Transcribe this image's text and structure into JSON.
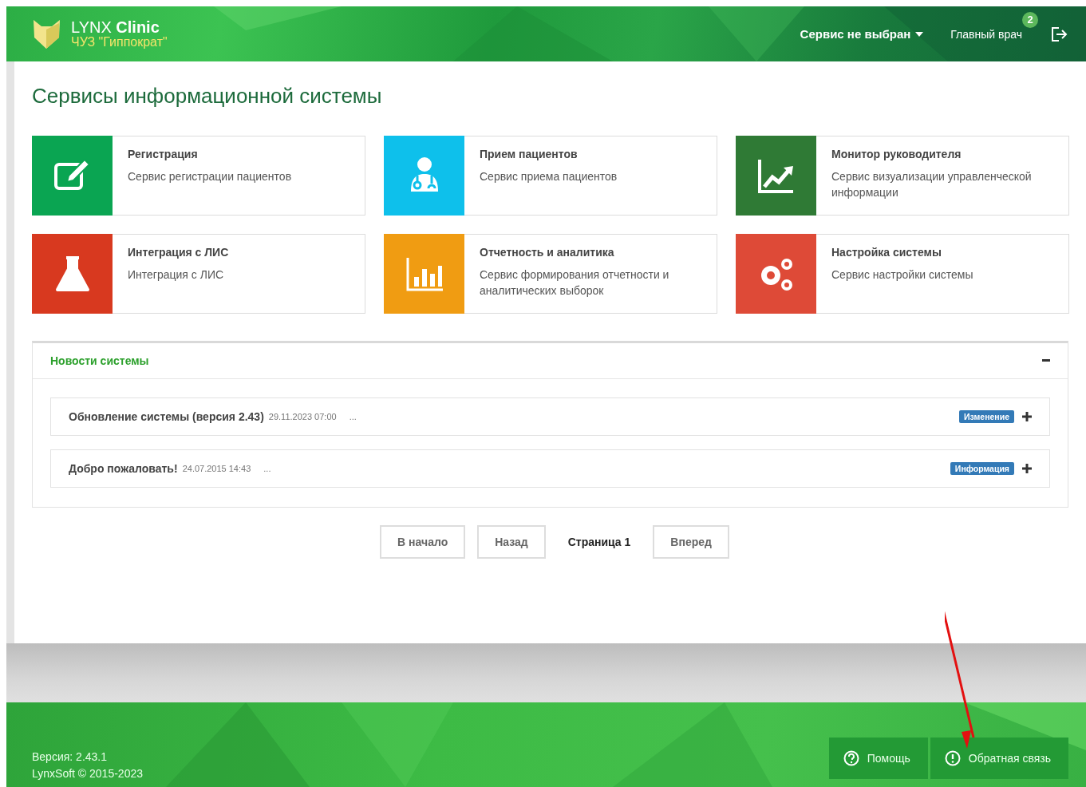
{
  "header": {
    "brand": "LYNX **Clinic**",
    "organization": "ЧУЗ \"Гиппократ\"",
    "service_menu": "Сервис не выбран",
    "user": "Главный врач",
    "notification_count": "2"
  },
  "page_title": "Сервисы информационной системы",
  "services": [
    {
      "title": "Регистрация",
      "description": "Сервис регистрации пациентов",
      "color": "#0aa552"
    },
    {
      "title": "Прием пациентов",
      "description": "Сервис приема пациентов",
      "color": "#0ec0eb"
    },
    {
      "title": "Монитор руководителя",
      "description": "Сервис визуализации управленческой информации",
      "color": "#2f7a35"
    },
    {
      "title": "Интеграция с ЛИС",
      "description": "Интеграция с ЛИС",
      "color": "#d8391f"
    },
    {
      "title": "Отчетность и аналитика",
      "description": "Сервис формирования отчетности и аналитических выборок",
      "color": "#f09c12"
    },
    {
      "title": "Настройка системы",
      "description": "Сервис настройки системы",
      "color": "#de4a37"
    }
  ],
  "news": {
    "title": "Новости системы",
    "expanded": true,
    "items": [
      {
        "title": "Обновление системы (версия 2.43)",
        "date": "29.11.2023 07:00",
        "excerpt": "...",
        "tag": "Изменение",
        "expanded": false
      },
      {
        "title": "Добро пожаловать!",
        "date": "24.07.2015 14:43",
        "excerpt": "...",
        "tag": "Информация",
        "expanded": false
      }
    ]
  },
  "pager": {
    "first": "В начало",
    "prev": "Назад",
    "current": "Страница 1",
    "next": "Вперед"
  },
  "footer": {
    "version": "Версия: 2.43.1",
    "copyright": "LynxSoft © 2015-2023",
    "buttons": [
      "Помощь",
      "Обратная связь"
    ]
  }
}
